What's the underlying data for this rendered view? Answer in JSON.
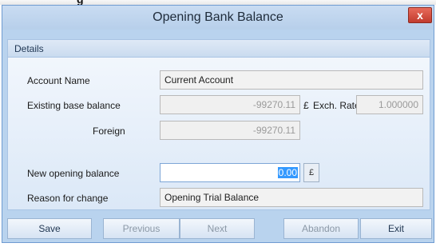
{
  "window": {
    "title": "Opening Bank Balance",
    "close_glyph": "x"
  },
  "details": {
    "header": "Details",
    "account_name_label": "Account Name",
    "account_name_value": "Current Account",
    "existing_label": "Existing base balance",
    "existing_value": "-99270.11",
    "existing_currency": "£",
    "exch_rate_label": "Exch. Rate",
    "exch_rate_value": "1.000000",
    "foreign_label": "Foreign",
    "foreign_value": "-99270.11",
    "new_opening_label": "New opening balance",
    "new_opening_value": "0.00",
    "new_opening_currency": "£",
    "reason_label": "Reason for change",
    "reason_value": "Opening Trial Balance"
  },
  "buttons": {
    "save": "Save",
    "previous": "Previous",
    "next": "Next",
    "abandon": "Abandon",
    "exit": "Exit"
  }
}
